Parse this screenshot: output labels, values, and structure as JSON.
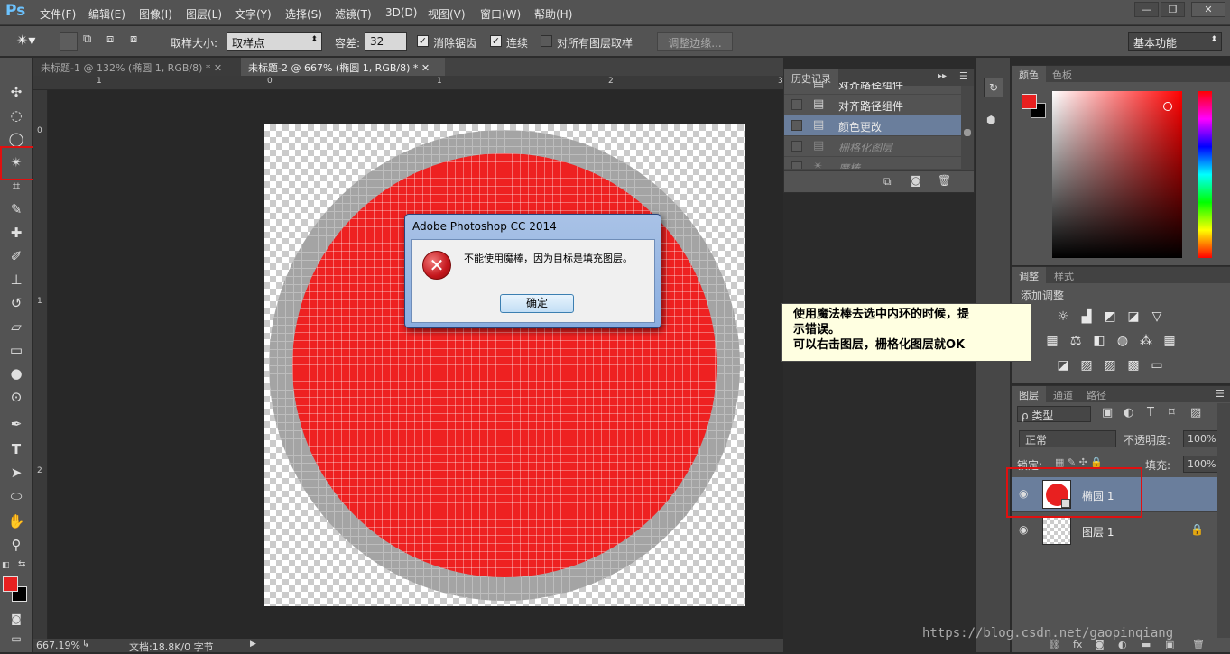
{
  "app": {
    "logo": "Ps"
  },
  "menu": [
    "文件(F)",
    "编辑(E)",
    "图像(I)",
    "图层(L)",
    "文字(Y)",
    "选择(S)",
    "滤镜(T)",
    "3D(D)",
    "视图(V)",
    "窗口(W)",
    "帮助(H)"
  ],
  "window_controls": [
    "—",
    "❐",
    "✕"
  ],
  "options": {
    "sample_size_label": "取样大小:",
    "sample_size_value": "取样点",
    "tolerance_label": "容差:",
    "tolerance_value": "32",
    "antialias_label": "消除锯齿",
    "contiguous_label": "连续",
    "sample_all_label": "对所有图层取样",
    "refine_edge_label": "调整边缘...",
    "workspace_value": "基本功能"
  },
  "tabs": [
    {
      "label": "未标题-1 @ 132% (椭圆 1, RGB/8) *",
      "close": "✕"
    },
    {
      "label": "未标题-2 @ 667% (椭圆 1, RGB/8) *",
      "close": "✕"
    }
  ],
  "ruler": {
    "h": [
      "1",
      "0",
      "1",
      "2",
      "3"
    ],
    "v": [
      "0",
      "1",
      "2"
    ]
  },
  "status": {
    "zoom": "667.19%",
    "doc": "文档:18.8K/0 字节"
  },
  "history": {
    "title": "历史记录",
    "items": [
      "对齐路径组件",
      "对齐路径组件",
      "颜色更改",
      "栅格化图层",
      "魔棒"
    ]
  },
  "color_panel": {
    "tab_active": "颜色",
    "tab_other": "色板"
  },
  "adjust_panel": {
    "tab_active": "调整",
    "tab_other": "样式",
    "add_label": "添加调整"
  },
  "layers_panel": {
    "tabs": [
      "图层",
      "通道",
      "路径"
    ],
    "filter_label": "ρ 类型",
    "blend_mode": "正常",
    "opacity_label": "不透明度:",
    "opacity_value": "100%",
    "lock_label": "锁定:",
    "fill_label": "填充:",
    "fill_value": "100%",
    "layers": [
      {
        "name": "椭圆 1",
        "selected": true
      },
      {
        "name": "图层 1",
        "locked": true
      }
    ]
  },
  "dialog": {
    "title": "Adobe Photoshop CC 2014",
    "message": "不能使用魔棒，因为目标是填充图层。",
    "ok": "确定"
  },
  "note": {
    "line1": "使用魔法棒去选中内环的时候，提",
    "line2": "示错误。",
    "line3": "可以右击图层，栅格化图层就OK"
  },
  "watermark": "https://blog.csdn.net/gaopinqiang",
  "colors": {
    "foreground": "#e82020",
    "accent_red": "#e01010"
  }
}
